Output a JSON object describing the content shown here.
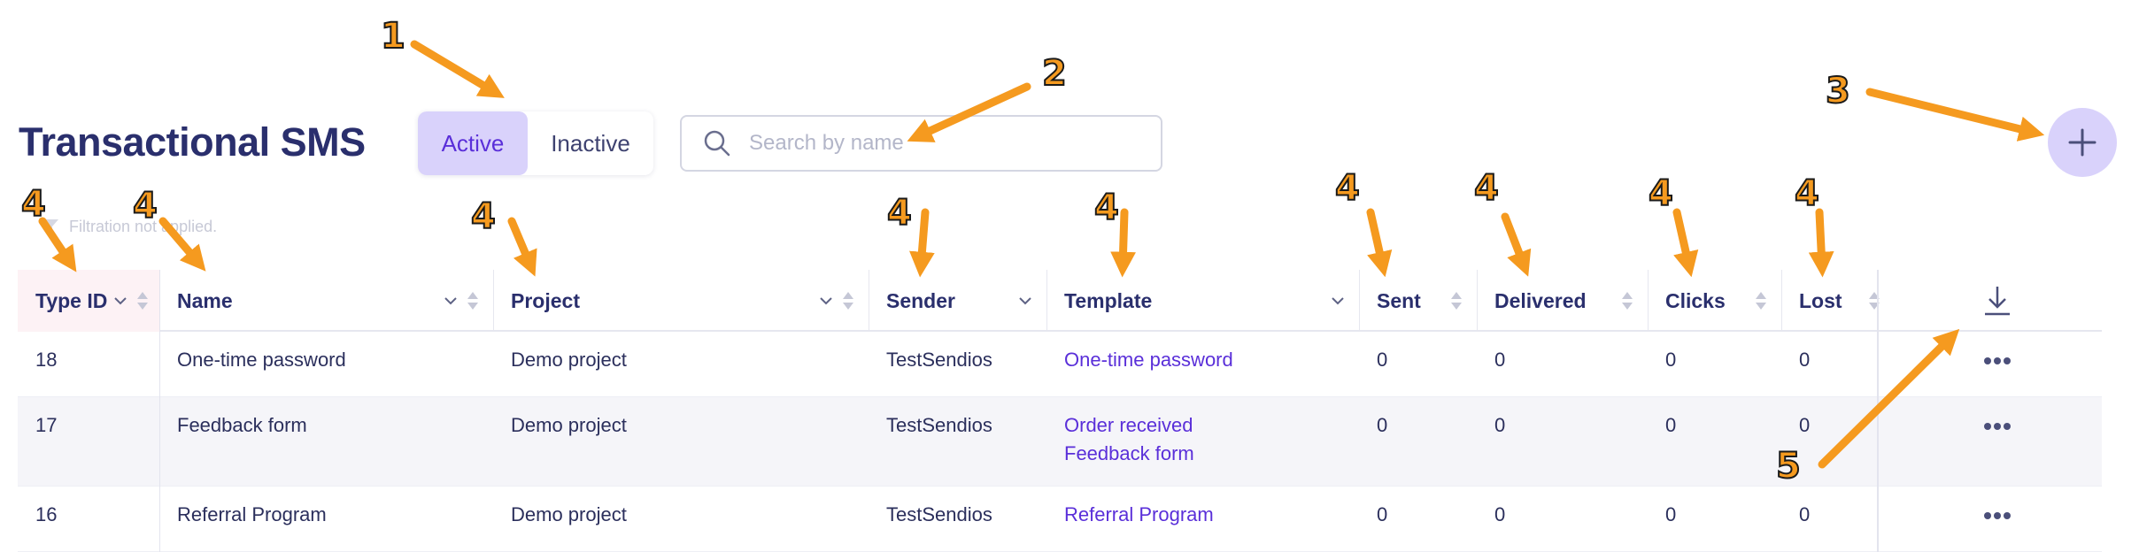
{
  "page_title": "Transactional SMS",
  "status_toggle": {
    "active_label": "Active",
    "inactive_label": "Inactive"
  },
  "search": {
    "placeholder": "Search by name"
  },
  "filter_status": "Filtration not applied.",
  "table": {
    "columns": [
      "Type ID",
      "Name",
      "Project",
      "Sender",
      "Template",
      "Sent",
      "Delivered",
      "Clicks",
      "Lost"
    ],
    "rows": [
      {
        "type_id": "18",
        "name": "One-time password",
        "project": "Demo project",
        "sender": "TestSendios",
        "templates": [
          "One-time password"
        ],
        "sent": "0",
        "delivered": "0",
        "clicks": "0",
        "lost": "0"
      },
      {
        "type_id": "17",
        "name": "Feedback form",
        "project": "Demo project",
        "sender": "TestSendios",
        "templates": [
          "Order received",
          "Feedback form"
        ],
        "sent": "0",
        "delivered": "0",
        "clicks": "0",
        "lost": "0"
      },
      {
        "type_id": "16",
        "name": "Referral Program",
        "project": "Demo project",
        "sender": "TestSendios",
        "templates": [
          "Referral Program"
        ],
        "sent": "0",
        "delivered": "0",
        "clicks": "0",
        "lost": "0"
      }
    ]
  },
  "annotations": [
    "1",
    "2",
    "3",
    "4",
    "4",
    "4",
    "4",
    "4",
    "4",
    "4",
    "4",
    "4",
    "5"
  ],
  "icons": {
    "search": "search-icon",
    "add": "plus-icon",
    "download": "download-icon",
    "more": "more-icon",
    "filter": "filter-icon",
    "sort": "sort-icon",
    "dropdown": "chevron-down-icon"
  },
  "colors": {
    "title": "#2a2f6d",
    "accent": "#5a2fd9",
    "accent_bg": "#d9d2fb",
    "annotation": "#f59a1f"
  }
}
